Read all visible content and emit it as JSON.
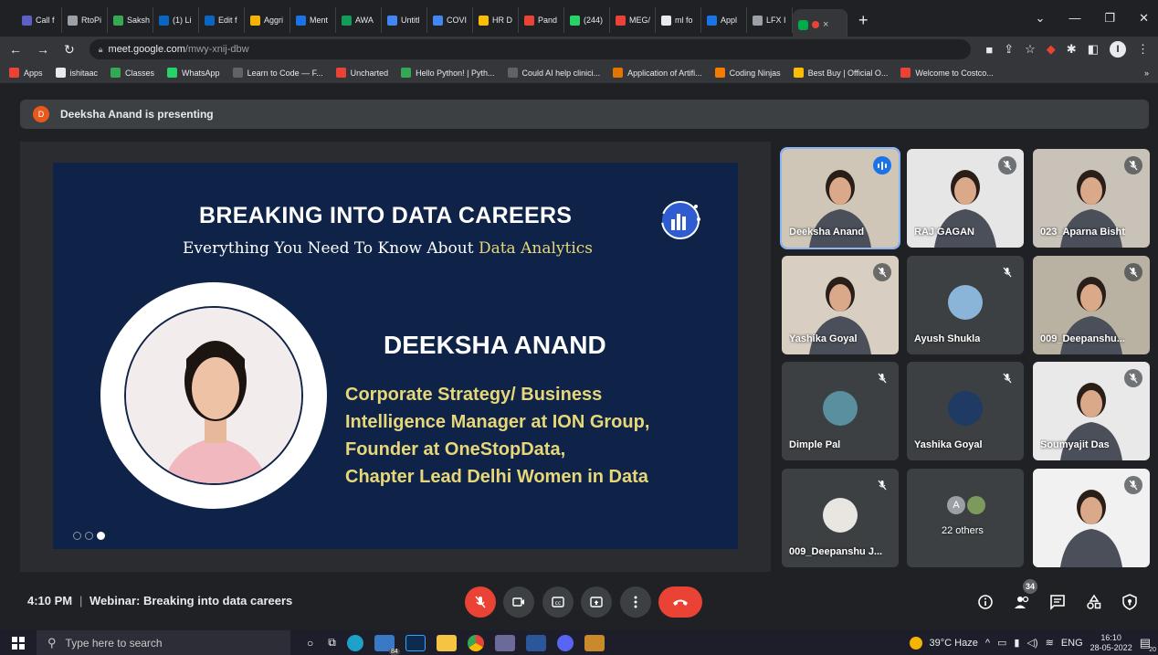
{
  "browser": {
    "tabs": [
      {
        "label": "Call f",
        "color": "#5b5fc7"
      },
      {
        "label": "RtoPi",
        "color": "#9aa0a6"
      },
      {
        "label": "Saksh",
        "color": "#34a853"
      },
      {
        "label": "(1) Li",
        "color": "#0a66c2"
      },
      {
        "label": "Edit f",
        "color": "#0a66c2"
      },
      {
        "label": "Aggri",
        "color": "#f4b400"
      },
      {
        "label": "Ment",
        "color": "#1a73e8"
      },
      {
        "label": "AWA",
        "color": "#0f9d58"
      },
      {
        "label": "Untitl",
        "color": "#4285f4"
      },
      {
        "label": "COVI",
        "color": "#4285f4"
      },
      {
        "label": "HR D",
        "color": "#fbbc04"
      },
      {
        "label": "Pand",
        "color": "#ea4335"
      },
      {
        "label": "(244)",
        "color": "#25d366"
      },
      {
        "label": "MEG/",
        "color": "#ea4335"
      },
      {
        "label": "ml fo",
        "color": "#e8eaed"
      },
      {
        "label": "Appl",
        "color": "#1a73e8"
      },
      {
        "label": "LFX I",
        "color": "#9aa0a6"
      }
    ],
    "active_tab_close": "×",
    "new_tab": "+",
    "url_host": "meet.google.com",
    "url_path": "/mwy-xnij-dbw",
    "bookmarks": [
      {
        "label": "Apps",
        "color": "#ea4335"
      },
      {
        "label": "ishitaac",
        "color": "#e8eaed"
      },
      {
        "label": "Classes",
        "color": "#34a853"
      },
      {
        "label": "WhatsApp",
        "color": "#25d366"
      },
      {
        "label": "Learn to Code — F...",
        "color": "#5f6368"
      },
      {
        "label": "Uncharted",
        "color": "#ea4335"
      },
      {
        "label": "Hello Python! | Pyth...",
        "color": "#34a853"
      },
      {
        "label": "Could AI help clinici...",
        "color": "#5f6368"
      },
      {
        "label": "Application of Artifi...",
        "color": "#e37400"
      },
      {
        "label": "Coding Ninjas",
        "color": "#f57c00"
      },
      {
        "label": "Best Buy | Official O...",
        "color": "#fbbc04"
      },
      {
        "label": "Welcome to Costco...",
        "color": "#ea4335"
      }
    ],
    "bookmarks_more": "»"
  },
  "meet": {
    "presenting_initial": "D",
    "presenting_text": "Deeksha Anand is presenting",
    "slide": {
      "title": "BREAKING INTO DATA CAREERS",
      "subtitle_plain": "Everything You Need To Know About ",
      "subtitle_highlight": "Data Analytics",
      "speaker_name": "DEEKSHA ANAND",
      "role_lines": [
        "Corporate Strategy/ Business",
        "Intelligence Manager at ION Group,",
        "Founder at OneStopData,",
        "Chapter Lead Delhi Women in Data"
      ]
    },
    "participants": [
      {
        "name": "Deeksha Anand",
        "state": "speaking"
      },
      {
        "name": "RAJ GAGAN",
        "state": "muted"
      },
      {
        "name": "023_Aparna Bisht",
        "state": "muted"
      },
      {
        "name": "Yashika Goyal",
        "state": "muted"
      },
      {
        "name": "Ayush Shukla",
        "state": "muted"
      },
      {
        "name": "009_Deepanshu...",
        "state": "muted"
      },
      {
        "name": "Dimple Pal",
        "state": "muted"
      },
      {
        "name": "Yashika Goyal",
        "state": "muted"
      },
      {
        "name": "Soumyajit Das",
        "state": "muted"
      },
      {
        "name": "009_Deepanshu J...",
        "state": "muted"
      },
      {
        "name": "22 others",
        "state": "group",
        "initial": "A"
      },
      {
        "name": "",
        "state": "muted"
      }
    ],
    "time": "4:10 PM",
    "separator": "|",
    "meeting_title": "Webinar: Breaking into data careers",
    "participant_count": "34"
  },
  "taskbar": {
    "search_placeholder": "Type here to search",
    "weather": "39°C Haze",
    "language": "ENG",
    "time": "16:10",
    "date": "28-05-2022",
    "notification_count": "20",
    "store_badge": "84"
  },
  "colors": {
    "slide_bg": "#0e2347",
    "accent_yellow": "#e7d779",
    "red_button": "#ea4335",
    "speaking_blue": "#1a73e8"
  }
}
